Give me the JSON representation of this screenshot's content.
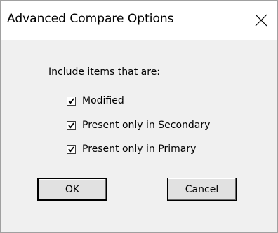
{
  "window": {
    "title": "Advanced Compare Options"
  },
  "group": {
    "label": "Include items that are:",
    "options": [
      {
        "label": "Modified",
        "checked": true
      },
      {
        "label": "Present only in Secondary",
        "checked": true
      },
      {
        "label": "Present only in Primary",
        "checked": true
      }
    ]
  },
  "buttons": {
    "ok": "OK",
    "cancel": "Cancel"
  },
  "icons": {
    "close": "close-icon",
    "check": "checkmark-icon"
  },
  "colors": {
    "titlebar_bg": "#ffffff",
    "dialog_bg": "#f0f0f0",
    "button_bg": "#e1e1e1"
  }
}
